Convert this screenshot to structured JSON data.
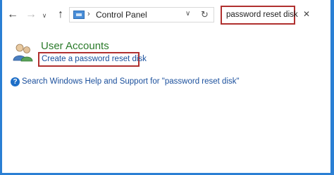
{
  "toolbar": {
    "back_icon": "arrow-left-icon",
    "forward_icon": "arrow-right-icon",
    "recent_icon": "chevron-down-icon",
    "up_icon": "arrow-up-icon"
  },
  "address_bar": {
    "icon": "control-panel-icon",
    "separator": "›",
    "crumb": "Control Panel",
    "dropdown_icon": "chevron-down-icon",
    "refresh_icon": "refresh-icon"
  },
  "search": {
    "value": "password reset disk",
    "clear_icon": "close-icon"
  },
  "results": {
    "category_title": "User Accounts",
    "category_icon": "user-accounts-icon",
    "task_link": "Create a password reset disk"
  },
  "help": {
    "icon": "help-icon",
    "link": "Search Windows Help and Support for \"password reset disk\""
  },
  "colors": {
    "accent_border": "#2a7fd4",
    "highlight": "#b0302f",
    "category": "#2a7a2a",
    "link": "#1a4f9c"
  }
}
